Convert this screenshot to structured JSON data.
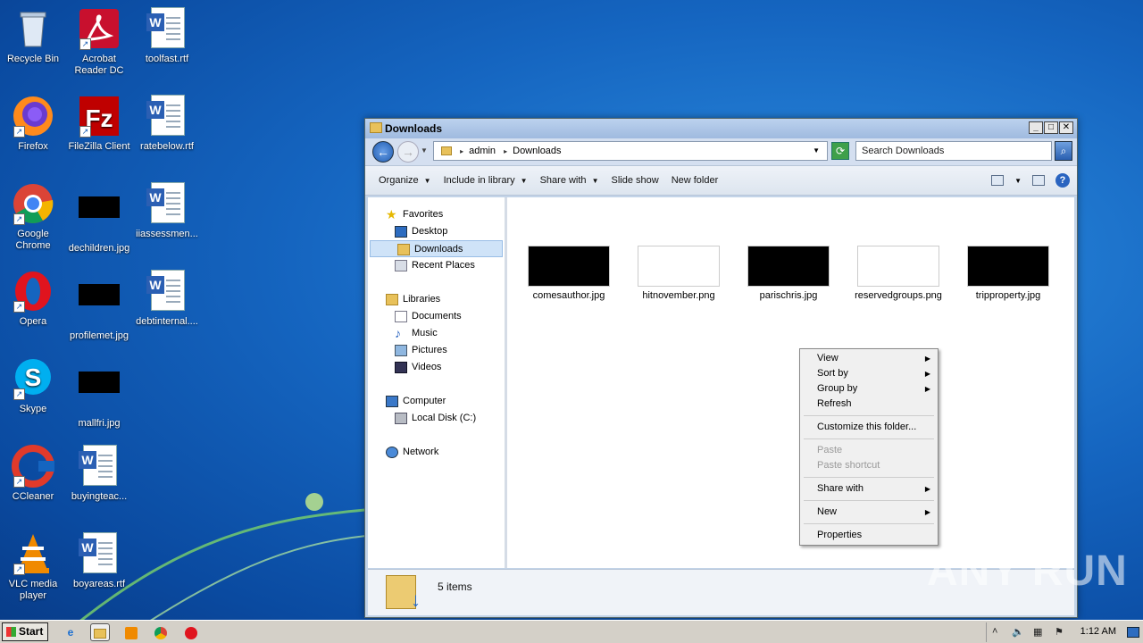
{
  "desktop": {
    "icons": [
      {
        "label": "Recycle Bin",
        "icon": "recycle-bin-icon"
      },
      {
        "label": "Acrobat Reader DC",
        "icon": "acrobat-icon"
      },
      {
        "label": "toolfast.rtf",
        "icon": "word-doc-icon"
      },
      {
        "label": "Firefox",
        "icon": "firefox-icon"
      },
      {
        "label": "FileZilla Client",
        "icon": "filezilla-icon"
      },
      {
        "label": "ratebelow.rtf",
        "icon": "word-doc-icon"
      },
      {
        "label": "Google Chrome",
        "icon": "chrome-icon"
      },
      {
        "label": "dechildren.jpg",
        "icon": "image-thumb-icon"
      },
      {
        "label": "iiassessmen...",
        "icon": "word-doc-icon"
      },
      {
        "label": "Opera",
        "icon": "opera-icon"
      },
      {
        "label": "profilemet.jpg",
        "icon": "image-thumb-icon"
      },
      {
        "label": "debtinternal....",
        "icon": "word-doc-icon"
      },
      {
        "label": "Skype",
        "icon": "skype-icon"
      },
      {
        "label": "mallfri.jpg",
        "icon": "image-thumb-icon"
      },
      {
        "label": "CCleaner",
        "icon": "ccleaner-icon"
      },
      {
        "label": "buyingteac...",
        "icon": "word-doc-icon"
      },
      {
        "label": "VLC media player",
        "icon": "vlc-icon"
      },
      {
        "label": "boyareas.rtf",
        "icon": "word-doc-icon"
      }
    ]
  },
  "window": {
    "title": "Downloads",
    "address": {
      "crumbs": [
        "admin",
        "Downloads"
      ]
    },
    "search_placeholder": "Search Downloads",
    "toolbar": {
      "organize": "Organize",
      "include_in_library": "Include in library",
      "share_with": "Share with",
      "slide_show": "Slide show",
      "new_folder": "New folder"
    },
    "nav": {
      "favorites": "Favorites",
      "desktop": "Desktop",
      "downloads": "Downloads",
      "recent_places": "Recent Places",
      "libraries": "Libraries",
      "documents": "Documents",
      "music": "Music",
      "pictures": "Pictures",
      "videos": "Videos",
      "computer": "Computer",
      "local_disk": "Local Disk (C:)",
      "network": "Network"
    },
    "files": [
      {
        "name": "comesauthor.jpg",
        "thumb": "black"
      },
      {
        "name": "hitnovember.png",
        "thumb": "white"
      },
      {
        "name": "parischris.jpg",
        "thumb": "black"
      },
      {
        "name": "reservedgroups.png",
        "thumb": "white"
      },
      {
        "name": "tripproperty.jpg",
        "thumb": "black"
      }
    ],
    "status": {
      "items": "5 items"
    }
  },
  "context_menu": {
    "view": "View",
    "sort_by": "Sort by",
    "group_by": "Group by",
    "refresh": "Refresh",
    "customize": "Customize this folder...",
    "paste": "Paste",
    "paste_shortcut": "Paste shortcut",
    "share_with": "Share with",
    "new": "New",
    "properties": "Properties"
  },
  "taskbar": {
    "start": "Start",
    "clock": "1:12 AM"
  },
  "watermark": "ANY RUN"
}
